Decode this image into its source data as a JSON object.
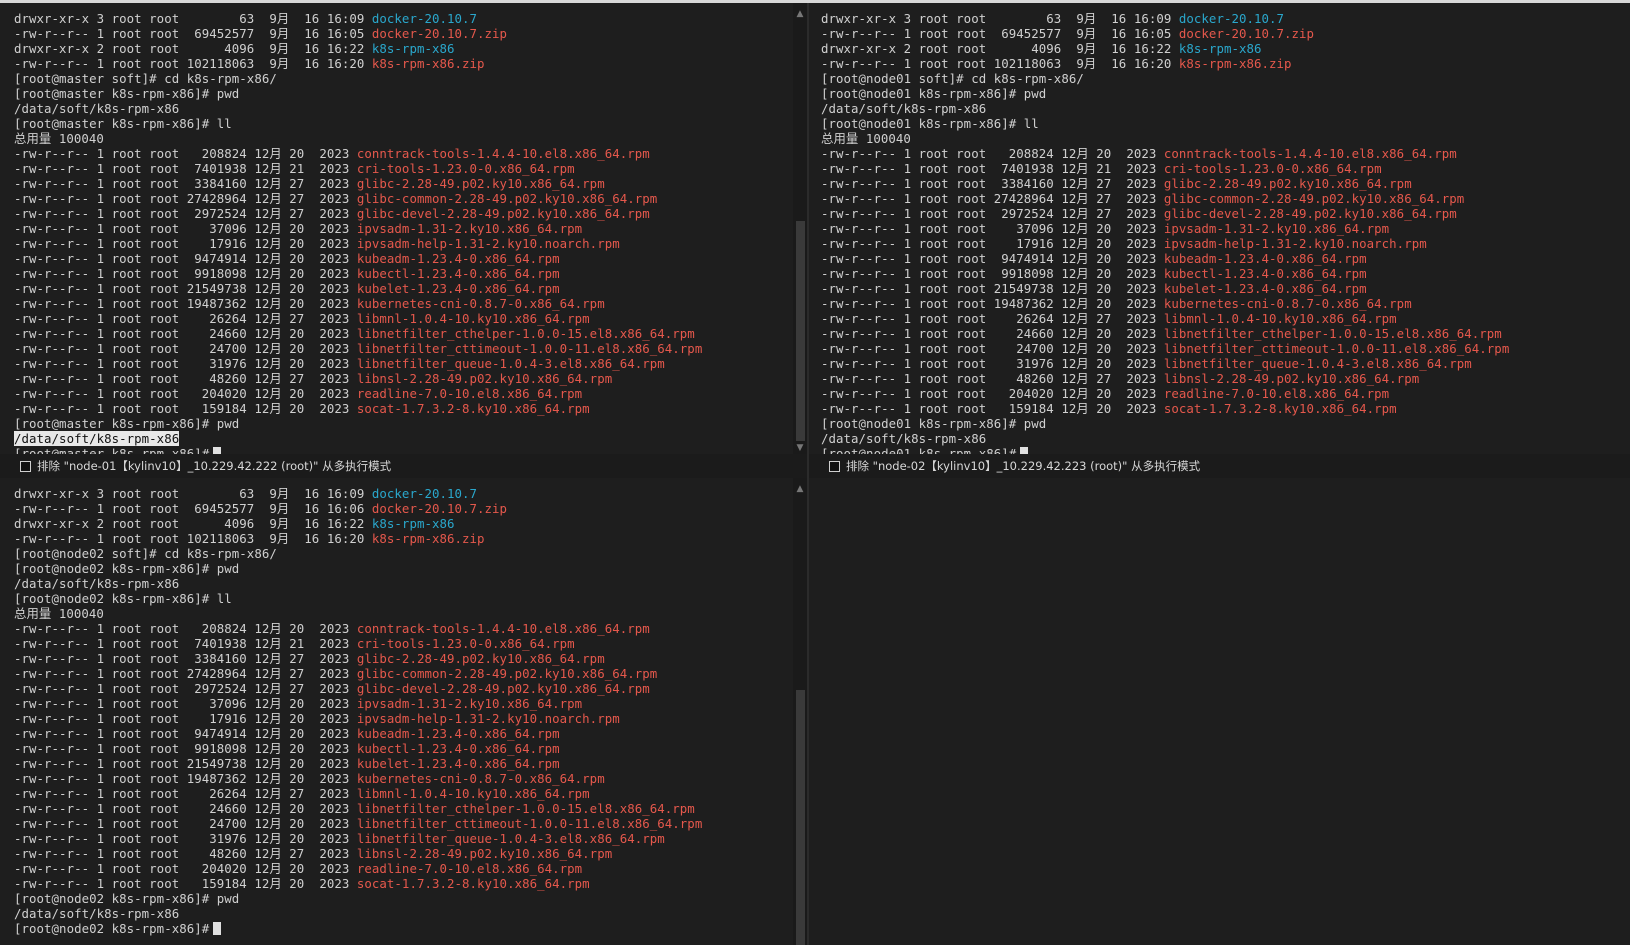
{
  "panes": {
    "master": {
      "lines": [
        [
          {
            "t": "drwxr-xr-x 3 root root        63  9月  16 16:09 "
          },
          {
            "t": "docker-20.10.7",
            "c": "dir"
          }
        ],
        [
          {
            "t": "-rw-r--r-- 1 root root  69452577  9月  16 16:05 "
          },
          {
            "t": "docker-20.10.7.zip",
            "c": "red"
          }
        ],
        [
          {
            "t": "drwxr-xr-x 2 root root      4096  9月  16 16:22 "
          },
          {
            "t": "k8s-rpm-x86",
            "c": "dir"
          }
        ],
        [
          {
            "t": "-rw-r--r-- 1 root root 102118063  9月  16 16:20 "
          },
          {
            "t": "k8s-rpm-x86.zip",
            "c": "red"
          }
        ],
        [
          {
            "t": "[root@master soft]# cd k8s-rpm-x86/"
          }
        ],
        [
          {
            "t": "[root@master k8s-rpm-x86]# pwd"
          }
        ],
        [
          {
            "t": "/data/soft/k8s-rpm-x86"
          }
        ],
        [
          {
            "t": "[root@master k8s-rpm-x86]# ll"
          }
        ],
        [
          {
            "t": "总用量 100040"
          }
        ],
        [
          {
            "t": "-rw-r--r-- 1 root root   208824 12月 20  2023 "
          },
          {
            "t": "conntrack-tools-1.4.4-10.el8.x86_64.rpm",
            "c": "red"
          }
        ],
        [
          {
            "t": "-rw-r--r-- 1 root root  7401938 12月 21  2023 "
          },
          {
            "t": "cri-tools-1.23.0-0.x86_64.rpm",
            "c": "red"
          }
        ],
        [
          {
            "t": "-rw-r--r-- 1 root root  3384160 12月 27  2023 "
          },
          {
            "t": "glibc-2.28-49.p02.ky10.x86_64.rpm",
            "c": "red"
          }
        ],
        [
          {
            "t": "-rw-r--r-- 1 root root 27428964 12月 27  2023 "
          },
          {
            "t": "glibc-common-2.28-49.p02.ky10.x86_64.rpm",
            "c": "red"
          }
        ],
        [
          {
            "t": "-rw-r--r-- 1 root root  2972524 12月 27  2023 "
          },
          {
            "t": "glibc-devel-2.28-49.p02.ky10.x86_64.rpm",
            "c": "red"
          }
        ],
        [
          {
            "t": "-rw-r--r-- 1 root root    37096 12月 20  2023 "
          },
          {
            "t": "ipvsadm-1.31-2.ky10.x86_64.rpm",
            "c": "red"
          }
        ],
        [
          {
            "t": "-rw-r--r-- 1 root root    17916 12月 20  2023 "
          },
          {
            "t": "ipvsadm-help-1.31-2.ky10.noarch.rpm",
            "c": "red"
          }
        ],
        [
          {
            "t": "-rw-r--r-- 1 root root  9474914 12月 20  2023 "
          },
          {
            "t": "kubeadm-1.23.4-0.x86_64.rpm",
            "c": "red"
          }
        ],
        [
          {
            "t": "-rw-r--r-- 1 root root  9918098 12月 20  2023 "
          },
          {
            "t": "kubectl-1.23.4-0.x86_64.rpm",
            "c": "red"
          }
        ],
        [
          {
            "t": "-rw-r--r-- 1 root root 21549738 12月 20  2023 "
          },
          {
            "t": "kubelet-1.23.4-0.x86_64.rpm",
            "c": "red"
          }
        ],
        [
          {
            "t": "-rw-r--r-- 1 root root 19487362 12月 20  2023 "
          },
          {
            "t": "kubernetes-cni-0.8.7-0.x86_64.rpm",
            "c": "red"
          }
        ],
        [
          {
            "t": "-rw-r--r-- 1 root root    26264 12月 27  2023 "
          },
          {
            "t": "libmnl-1.0.4-10.ky10.x86_64.rpm",
            "c": "red"
          }
        ],
        [
          {
            "t": "-rw-r--r-- 1 root root    24660 12月 20  2023 "
          },
          {
            "t": "libnetfilter_cthelper-1.0.0-15.el8.x86_64.rpm",
            "c": "red"
          }
        ],
        [
          {
            "t": "-rw-r--r-- 1 root root    24700 12月 20  2023 "
          },
          {
            "t": "libnetfilter_cttimeout-1.0.0-11.el8.x86_64.rpm",
            "c": "red"
          }
        ],
        [
          {
            "t": "-rw-r--r-- 1 root root    31976 12月 20  2023 "
          },
          {
            "t": "libnetfilter_queue-1.0.4-3.el8.x86_64.rpm",
            "c": "red"
          }
        ],
        [
          {
            "t": "-rw-r--r-- 1 root root    48260 12月 27  2023 "
          },
          {
            "t": "libnsl-2.28-49.p02.ky10.x86_64.rpm",
            "c": "red"
          }
        ],
        [
          {
            "t": "-rw-r--r-- 1 root root   204020 12月 20  2023 "
          },
          {
            "t": "readline-7.0-10.el8.x86_64.rpm",
            "c": "red"
          }
        ],
        [
          {
            "t": "-rw-r--r-- 1 root root   159184 12月 20  2023 "
          },
          {
            "t": "socat-1.7.3.2-8.ky10.x86_64.rpm",
            "c": "red"
          }
        ],
        [
          {
            "t": "[root@master k8s-rpm-x86]# pwd"
          }
        ],
        [
          {
            "t": "/data/soft/k8s-rpm-x86",
            "c": "sel"
          }
        ],
        [
          {
            "t": "[root@master k8s-rpm-x86]#"
          },
          {
            "cursor": true
          }
        ]
      ]
    },
    "node01": {
      "lines": [
        [
          {
            "t": "drwxr-xr-x 3 root root        63  9月  16 16:09 "
          },
          {
            "t": "docker-20.10.7",
            "c": "dir"
          }
        ],
        [
          {
            "t": "-rw-r--r-- 1 root root  69452577  9月  16 16:05 "
          },
          {
            "t": "docker-20.10.7.zip",
            "c": "red"
          }
        ],
        [
          {
            "t": "drwxr-xr-x 2 root root      4096  9月  16 16:22 "
          },
          {
            "t": "k8s-rpm-x86",
            "c": "dir"
          }
        ],
        [
          {
            "t": "-rw-r--r-- 1 root root 102118063  9月  16 16:20 "
          },
          {
            "t": "k8s-rpm-x86.zip",
            "c": "red"
          }
        ],
        [
          {
            "t": "[root@node01 soft]# cd k8s-rpm-x86/"
          }
        ],
        [
          {
            "t": "[root@node01 k8s-rpm-x86]# pwd"
          }
        ],
        [
          {
            "t": "/data/soft/k8s-rpm-x86"
          }
        ],
        [
          {
            "t": "[root@node01 k8s-rpm-x86]# ll"
          }
        ],
        [
          {
            "t": "总用量 100040"
          }
        ],
        [
          {
            "t": "-rw-r--r-- 1 root root   208824 12月 20  2023 "
          },
          {
            "t": "conntrack-tools-1.4.4-10.el8.x86_64.rpm",
            "c": "red"
          }
        ],
        [
          {
            "t": "-rw-r--r-- 1 root root  7401938 12月 21  2023 "
          },
          {
            "t": "cri-tools-1.23.0-0.x86_64.rpm",
            "c": "red"
          }
        ],
        [
          {
            "t": "-rw-r--r-- 1 root root  3384160 12月 27  2023 "
          },
          {
            "t": "glibc-2.28-49.p02.ky10.x86_64.rpm",
            "c": "red"
          }
        ],
        [
          {
            "t": "-rw-r--r-- 1 root root 27428964 12月 27  2023 "
          },
          {
            "t": "glibc-common-2.28-49.p02.ky10.x86_64.rpm",
            "c": "red"
          }
        ],
        [
          {
            "t": "-rw-r--r-- 1 root root  2972524 12月 27  2023 "
          },
          {
            "t": "glibc-devel-2.28-49.p02.ky10.x86_64.rpm",
            "c": "red"
          }
        ],
        [
          {
            "t": "-rw-r--r-- 1 root root    37096 12月 20  2023 "
          },
          {
            "t": "ipvsadm-1.31-2.ky10.x86_64.rpm",
            "c": "red"
          }
        ],
        [
          {
            "t": "-rw-r--r-- 1 root root    17916 12月 20  2023 "
          },
          {
            "t": "ipvsadm-help-1.31-2.ky10.noarch.rpm",
            "c": "red"
          }
        ],
        [
          {
            "t": "-rw-r--r-- 1 root root  9474914 12月 20  2023 "
          },
          {
            "t": "kubeadm-1.23.4-0.x86_64.rpm",
            "c": "red"
          }
        ],
        [
          {
            "t": "-rw-r--r-- 1 root root  9918098 12月 20  2023 "
          },
          {
            "t": "kubectl-1.23.4-0.x86_64.rpm",
            "c": "red"
          }
        ],
        [
          {
            "t": "-rw-r--r-- 1 root root 21549738 12月 20  2023 "
          },
          {
            "t": "kubelet-1.23.4-0.x86_64.rpm",
            "c": "red"
          }
        ],
        [
          {
            "t": "-rw-r--r-- 1 root root 19487362 12月 20  2023 "
          },
          {
            "t": "kubernetes-cni-0.8.7-0.x86_64.rpm",
            "c": "red"
          }
        ],
        [
          {
            "t": "-rw-r--r-- 1 root root    26264 12月 27  2023 "
          },
          {
            "t": "libmnl-1.0.4-10.ky10.x86_64.rpm",
            "c": "red"
          }
        ],
        [
          {
            "t": "-rw-r--r-- 1 root root    24660 12月 20  2023 "
          },
          {
            "t": "libnetfilter_cthelper-1.0.0-15.el8.x86_64.rpm",
            "c": "red"
          }
        ],
        [
          {
            "t": "-rw-r--r-- 1 root root    24700 12月 20  2023 "
          },
          {
            "t": "libnetfilter_cttimeout-1.0.0-11.el8.x86_64.rpm",
            "c": "red"
          }
        ],
        [
          {
            "t": "-rw-r--r-- 1 root root    31976 12月 20  2023 "
          },
          {
            "t": "libnetfilter_queue-1.0.4-3.el8.x86_64.rpm",
            "c": "red"
          }
        ],
        [
          {
            "t": "-rw-r--r-- 1 root root    48260 12月 27  2023 "
          },
          {
            "t": "libnsl-2.28-49.p02.ky10.x86_64.rpm",
            "c": "red"
          }
        ],
        [
          {
            "t": "-rw-r--r-- 1 root root   204020 12月 20  2023 "
          },
          {
            "t": "readline-7.0-10.el8.x86_64.rpm",
            "c": "red"
          }
        ],
        [
          {
            "t": "-rw-r--r-- 1 root root   159184 12月 20  2023 "
          },
          {
            "t": "socat-1.7.3.2-8.ky10.x86_64.rpm",
            "c": "red"
          }
        ],
        [
          {
            "t": "[root@node01 k8s-rpm-x86]# pwd"
          }
        ],
        [
          {
            "t": "/data/soft/k8s-rpm-x86"
          }
        ],
        [
          {
            "t": "[root@node01 k8s-rpm-x86]#"
          },
          {
            "cursor": true
          }
        ]
      ]
    },
    "node02": {
      "lines": [
        [
          {
            "t": "drwxr-xr-x 3 root root        63  9月  16 16:09 "
          },
          {
            "t": "docker-20.10.7",
            "c": "dir"
          }
        ],
        [
          {
            "t": "-rw-r--r-- 1 root root  69452577  9月  16 16:06 "
          },
          {
            "t": "docker-20.10.7.zip",
            "c": "red"
          }
        ],
        [
          {
            "t": "drwxr-xr-x 2 root root      4096  9月  16 16:22 "
          },
          {
            "t": "k8s-rpm-x86",
            "c": "dir"
          }
        ],
        [
          {
            "t": "-rw-r--r-- 1 root root 102118063  9月  16 16:20 "
          },
          {
            "t": "k8s-rpm-x86.zip",
            "c": "red"
          }
        ],
        [
          {
            "t": "[root@node02 soft]# cd k8s-rpm-x86/"
          }
        ],
        [
          {
            "t": "[root@node02 k8s-rpm-x86]# pwd"
          }
        ],
        [
          {
            "t": "/data/soft/k8s-rpm-x86"
          }
        ],
        [
          {
            "t": "[root@node02 k8s-rpm-x86]# ll"
          }
        ],
        [
          {
            "t": "总用量 100040"
          }
        ],
        [
          {
            "t": "-rw-r--r-- 1 root root   208824 12月 20  2023 "
          },
          {
            "t": "conntrack-tools-1.4.4-10.el8.x86_64.rpm",
            "c": "red"
          }
        ],
        [
          {
            "t": "-rw-r--r-- 1 root root  7401938 12月 21  2023 "
          },
          {
            "t": "cri-tools-1.23.0-0.x86_64.rpm",
            "c": "red"
          }
        ],
        [
          {
            "t": "-rw-r--r-- 1 root root  3384160 12月 27  2023 "
          },
          {
            "t": "glibc-2.28-49.p02.ky10.x86_64.rpm",
            "c": "red"
          }
        ],
        [
          {
            "t": "-rw-r--r-- 1 root root 27428964 12月 27  2023 "
          },
          {
            "t": "glibc-common-2.28-49.p02.ky10.x86_64.rpm",
            "c": "red"
          }
        ],
        [
          {
            "t": "-rw-r--r-- 1 root root  2972524 12月 27  2023 "
          },
          {
            "t": "glibc-devel-2.28-49.p02.ky10.x86_64.rpm",
            "c": "red"
          }
        ],
        [
          {
            "t": "-rw-r--r-- 1 root root    37096 12月 20  2023 "
          },
          {
            "t": "ipvsadm-1.31-2.ky10.x86_64.rpm",
            "c": "red"
          }
        ],
        [
          {
            "t": "-rw-r--r-- 1 root root    17916 12月 20  2023 "
          },
          {
            "t": "ipvsadm-help-1.31-2.ky10.noarch.rpm",
            "c": "red"
          }
        ],
        [
          {
            "t": "-rw-r--r-- 1 root root  9474914 12月 20  2023 "
          },
          {
            "t": "kubeadm-1.23.4-0.x86_64.rpm",
            "c": "red"
          }
        ],
        [
          {
            "t": "-rw-r--r-- 1 root root  9918098 12月 20  2023 "
          },
          {
            "t": "kubectl-1.23.4-0.x86_64.rpm",
            "c": "red"
          }
        ],
        [
          {
            "t": "-rw-r--r-- 1 root root 21549738 12月 20  2023 "
          },
          {
            "t": "kubelet-1.23.4-0.x86_64.rpm",
            "c": "red"
          }
        ],
        [
          {
            "t": "-rw-r--r-- 1 root root 19487362 12月 20  2023 "
          },
          {
            "t": "kubernetes-cni-0.8.7-0.x86_64.rpm",
            "c": "red"
          }
        ],
        [
          {
            "t": "-rw-r--r-- 1 root root    26264 12月 27  2023 "
          },
          {
            "t": "libmnl-1.0.4-10.ky10.x86_64.rpm",
            "c": "red"
          }
        ],
        [
          {
            "t": "-rw-r--r-- 1 root root    24660 12月 20  2023 "
          },
          {
            "t": "libnetfilter_cthelper-1.0.0-15.el8.x86_64.rpm",
            "c": "red"
          }
        ],
        [
          {
            "t": "-rw-r--r-- 1 root root    24700 12月 20  2023 "
          },
          {
            "t": "libnetfilter_cttimeout-1.0.0-11.el8.x86_64.rpm",
            "c": "red"
          }
        ],
        [
          {
            "t": "-rw-r--r-- 1 root root    31976 12月 20  2023 "
          },
          {
            "t": "libnetfilter_queue-1.0.4-3.el8.x86_64.rpm",
            "c": "red"
          }
        ],
        [
          {
            "t": "-rw-r--r-- 1 root root    48260 12月 27  2023 "
          },
          {
            "t": "libnsl-2.28-49.p02.ky10.x86_64.rpm",
            "c": "red"
          }
        ],
        [
          {
            "t": "-rw-r--r-- 1 root root   204020 12月 20  2023 "
          },
          {
            "t": "readline-7.0-10.el8.x86_64.rpm",
            "c": "red"
          }
        ],
        [
          {
            "t": "-rw-r--r-- 1 root root   159184 12月 20  2023 "
          },
          {
            "t": "socat-1.7.3.2-8.ky10.x86_64.rpm",
            "c": "red"
          }
        ],
        [
          {
            "t": "[root@node02 k8s-rpm-x86]# pwd"
          }
        ],
        [
          {
            "t": "/data/soft/k8s-rpm-x86"
          }
        ],
        [
          {
            "t": "[root@node02 k8s-rpm-x86]#"
          },
          {
            "cursor": true
          }
        ]
      ]
    }
  },
  "exclude_bars": {
    "node01": "排除 \"node-01【kylinv10】_10.229.42.222 (root)\" 从多执行模式",
    "node02": "排除 \"node-02【kylinv10】_10.229.42.223 (root)\" 从多执行模式"
  },
  "colors": {
    "dir": "#2aa7cc",
    "file": "#e5584c",
    "text": "#d0d0d0",
    "bg": "#1e1e1e"
  },
  "icons": {
    "scroll_up": "chevron-up-icon",
    "scroll_down": "chevron-down-icon"
  }
}
